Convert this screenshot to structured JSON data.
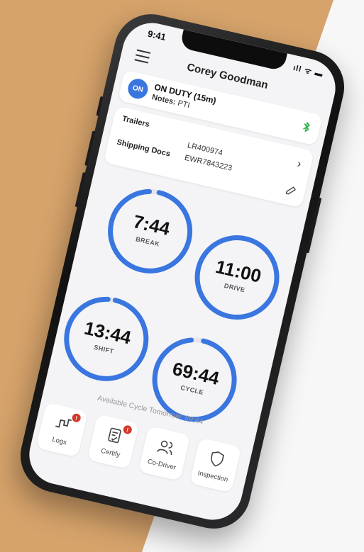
{
  "status_bar": {
    "time": "9:41",
    "signal": "ıll ᯤ ▬"
  },
  "header": {
    "driver_name": "Corey Goodman"
  },
  "status": {
    "badge": "ON",
    "duty": "ON DUTY (15m)",
    "notes_label": "Notes:",
    "notes_value": "PTI",
    "bluetooth_color": "#2db34a"
  },
  "documents": {
    "trailers_label": "Trailers",
    "trailers_value": "LR400974",
    "shipping_label": "Shipping Docs",
    "shipping_value": "EWR7843223"
  },
  "timers": [
    {
      "time": "7:44",
      "label": "BREAK",
      "progress": 0.96
    },
    {
      "time": "11:00",
      "label": "DRIVE",
      "progress": 1.0
    },
    {
      "time": "13:44",
      "label": "SHIFT",
      "progress": 0.97
    },
    {
      "time": "69:44",
      "label": "CYCLE",
      "progress": 0.95
    }
  ],
  "available_text": "Available Cycle Tomorrow: 69:44",
  "tabs": [
    {
      "label": "Logs",
      "icon": "logs-graph-icon",
      "alert": "!"
    },
    {
      "label": "Certify",
      "icon": "certify-document-icon",
      "alert": "!"
    },
    {
      "label": "Co-Driver",
      "icon": "co-driver-users-icon",
      "alert": ""
    },
    {
      "label": "Inspection",
      "icon": "inspection-shield-icon",
      "alert": ""
    }
  ],
  "colors": {
    "accent": "#3a76e0",
    "background": "#d6a36b",
    "alert": "#d23a2c"
  }
}
